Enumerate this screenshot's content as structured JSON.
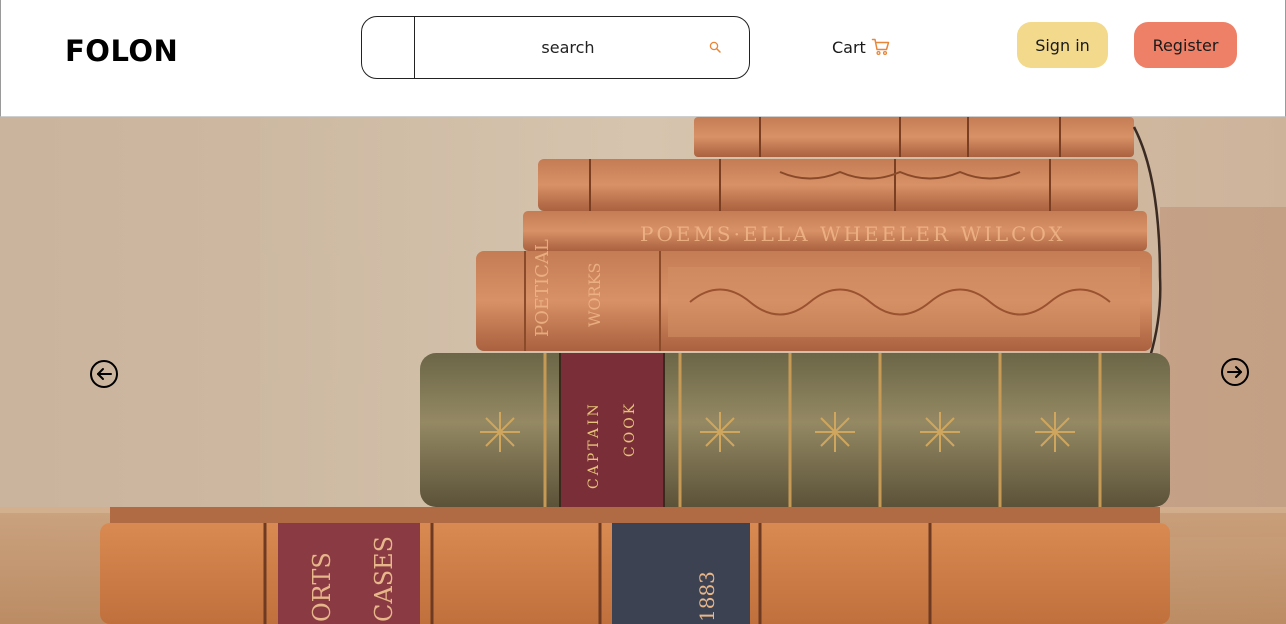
{
  "brand": {
    "logo_text": "FOLON"
  },
  "search": {
    "placeholder": "search",
    "value": "",
    "icon": "search-icon"
  },
  "nav": {
    "cart_label": "Cart",
    "cart_icon": "cart-icon",
    "sign_in_label": "Sign in",
    "register_label": "Register"
  },
  "hero": {
    "image": "stack-of-antique-books",
    "prev_icon": "arrow-left-circle-icon",
    "next_icon": "arrow-right-circle-icon",
    "spine_texts": [
      "CAPTAIN COOK",
      "POEMS · ELLA WHEELER WILCOX",
      "POETICAL WORKS",
      "CASES",
      "1883"
    ]
  },
  "colors": {
    "sign_in_bg": "#f2d98b",
    "register_bg": "#ee8068",
    "accent": "#e8863a",
    "text": "#1a1a1a"
  }
}
